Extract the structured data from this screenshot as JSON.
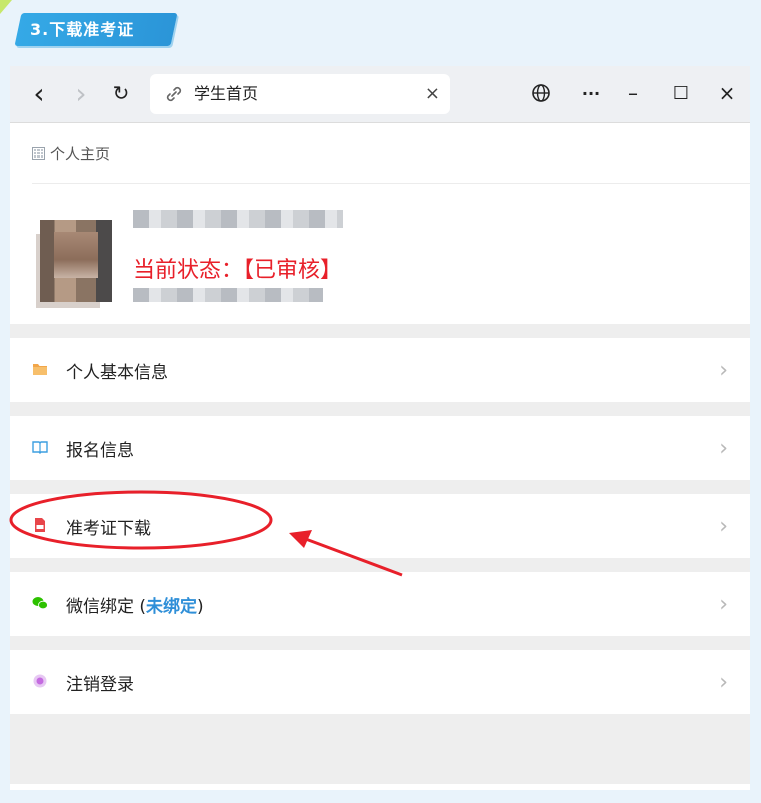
{
  "step_banner": {
    "label": "3.下载准考证"
  },
  "window": {
    "url": {
      "title": "学生首页"
    },
    "controls": {
      "back": "‹",
      "forward": "›",
      "refresh": "↻",
      "close_tab": "×",
      "more": "···",
      "minimize": "–",
      "maximize": "☐",
      "close_window": "×"
    }
  },
  "page": {
    "header": "个人主页",
    "status": "当前状态：【已审核】",
    "menu": [
      {
        "label": "个人基本信息",
        "icon": "folder-icon"
      },
      {
        "label": "报名信息",
        "icon": "book-icon"
      },
      {
        "label": "准考证下载",
        "icon": "pdf-icon"
      },
      {
        "label": "微信绑定 (",
        "status": "未绑定",
        "suffix": ")",
        "icon": "wechat-icon"
      },
      {
        "label": "注销登录",
        "icon": "logout-icon"
      }
    ],
    "chevron": "›"
  },
  "colors": {
    "accent": "#2b95d8",
    "status": "#e8202a",
    "annotation": "#e8202a"
  }
}
